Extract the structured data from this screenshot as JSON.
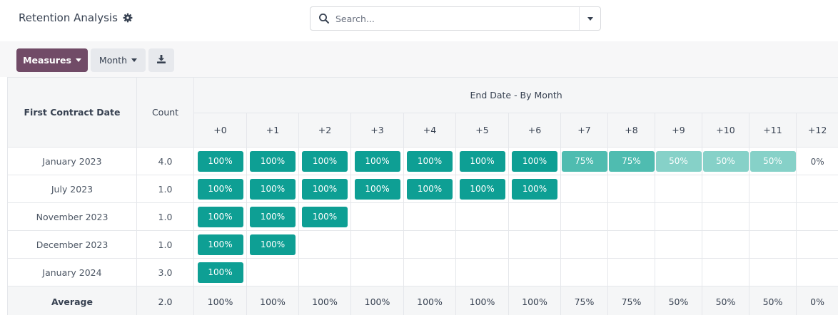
{
  "header": {
    "title": "Retention Analysis",
    "settings_icon": "gear-icon"
  },
  "search": {
    "placeholder": "Search...",
    "icon": "search-icon"
  },
  "toolbar": {
    "measures_label": "Measures",
    "month_label": "Month",
    "download_icon": "download-icon"
  },
  "colors": {
    "strong": "#0e9f94",
    "medium": "#4fbcb0",
    "light": "#86d1c8",
    "brand": "#714b67"
  },
  "table": {
    "row_header": "First Contract Date",
    "count_header": "Count",
    "group_header": "End Date - By Month",
    "columns": [
      "+0",
      "+1",
      "+2",
      "+3",
      "+4",
      "+5",
      "+6",
      "+7",
      "+8",
      "+9",
      "+10",
      "+11",
      "+12"
    ],
    "rows": [
      {
        "label": "January 2023",
        "count": "4.0",
        "values": [
          "100%",
          "100%",
          "100%",
          "100%",
          "100%",
          "100%",
          "100%",
          "75%",
          "75%",
          "50%",
          "50%",
          "50%",
          "0%"
        ]
      },
      {
        "label": "July 2023",
        "count": "1.0",
        "values": [
          "100%",
          "100%",
          "100%",
          "100%",
          "100%",
          "100%",
          "100%",
          "",
          "",
          "",
          "",
          "",
          ""
        ]
      },
      {
        "label": "November 2023",
        "count": "1.0",
        "values": [
          "100%",
          "100%",
          "100%",
          "",
          "",
          "",
          "",
          "",
          "",
          "",
          "",
          "",
          ""
        ]
      },
      {
        "label": "December 2023",
        "count": "1.0",
        "values": [
          "100%",
          "100%",
          "",
          "",
          "",
          "",
          "",
          "",
          "",
          "",
          "",
          "",
          ""
        ]
      },
      {
        "label": "January 2024",
        "count": "3.0",
        "values": [
          "100%",
          "",
          "",
          "",
          "",
          "",
          "",
          "",
          "",
          "",
          "",
          "",
          ""
        ]
      }
    ],
    "footer": {
      "label": "Average",
      "count": "2.0",
      "values": [
        "100%",
        "100%",
        "100%",
        "100%",
        "100%",
        "100%",
        "100%",
        "75%",
        "75%",
        "50%",
        "50%",
        "50%",
        "0%"
      ]
    }
  }
}
